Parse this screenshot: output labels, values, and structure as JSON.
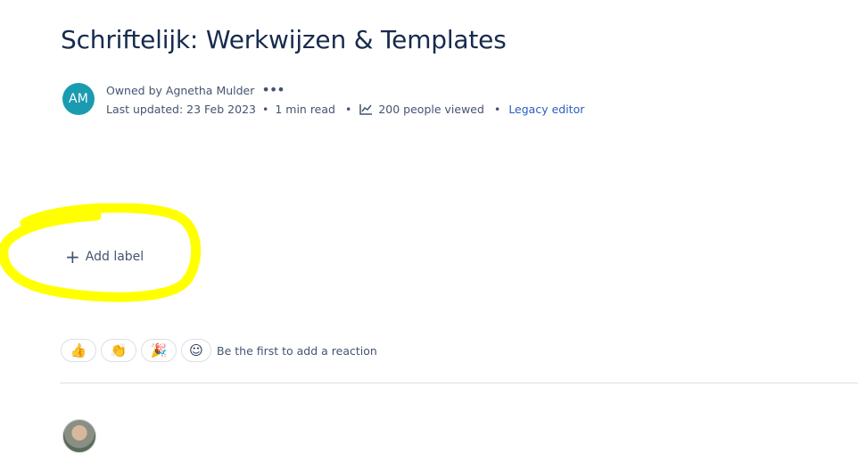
{
  "page": {
    "title": "Schriftelijk: Werkwijzen & Templates"
  },
  "byline": {
    "avatar_initials": "AM",
    "owned_by": "Owned by Agnetha Mulder",
    "more_icon": "ellipsis-icon",
    "last_updated": "Last updated: 23 Feb 2023",
    "read_time": "1 min read",
    "views": "200 people viewed",
    "editor_link": "Legacy editor"
  },
  "labels": {
    "add_label": "Add label"
  },
  "reactions": {
    "items": [
      {
        "name": "thumbs-up",
        "glyph": "👍"
      },
      {
        "name": "clapping-hands",
        "glyph": "👏"
      },
      {
        "name": "party-popper",
        "glyph": "🎉"
      }
    ],
    "add_icon": "☺",
    "prompt": "Be the first to add a reaction"
  },
  "colors": {
    "title": "#172b4d",
    "meta": "#44546f",
    "link": "#2a5ec2",
    "avatar_bg": "#1a9bb0",
    "highlight": "#ffff00",
    "divider": "#dcdfe4"
  }
}
